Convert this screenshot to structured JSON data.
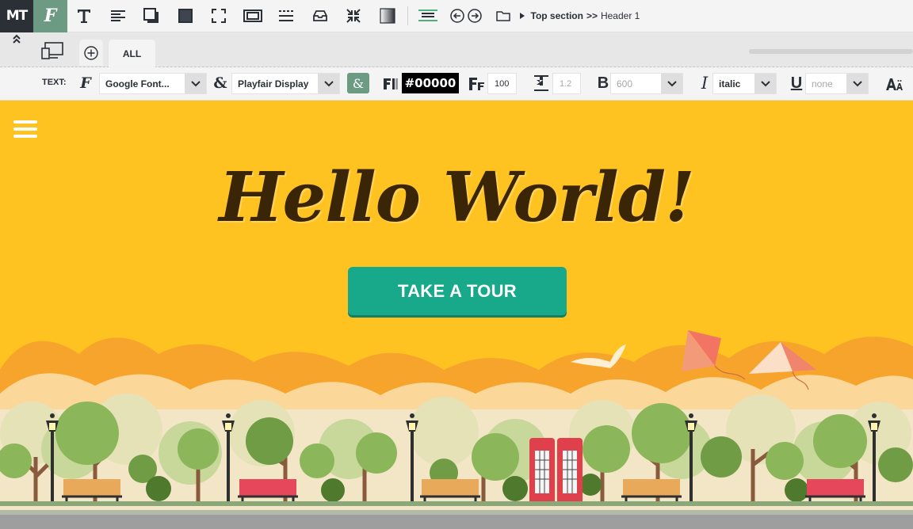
{
  "toolbar": {
    "logo_text": "MT",
    "font_button": "F",
    "breadcrumb": {
      "section": "Top section",
      "separator": ">>",
      "item": "Header 1"
    }
  },
  "tabs": {
    "active_label": "ALL"
  },
  "text_toolbar": {
    "label": "TEXT:",
    "font_source": "Google Font...",
    "font_family": "Playfair Display",
    "color_value": "#00000",
    "font_size": "100",
    "line_height": "1.2",
    "font_weight": "600",
    "font_style": "italic",
    "text_decoration": "none"
  },
  "hero": {
    "title": "Hello World!",
    "cta_label": "TAKE A TOUR"
  },
  "colors": {
    "canvas_bg": "#ffc321",
    "accent_green": "#6c9a83",
    "cta_green": "#18a98b",
    "title_color": "#3a2607"
  },
  "icons": [
    "text-tool-icon",
    "align-icon",
    "shadow-icon",
    "background-icon",
    "fullscreen-icon",
    "border-icon",
    "spacing-icon",
    "image-icon",
    "collapse-icon",
    "gradient-icon",
    "layers-icon",
    "undo-icon",
    "redo-icon",
    "folder-icon"
  ]
}
